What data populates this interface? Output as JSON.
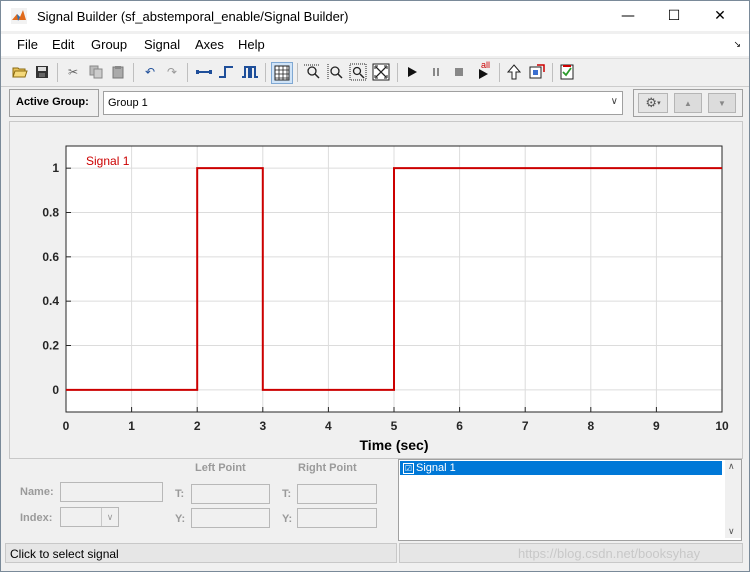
{
  "window": {
    "title": "Signal Builder (sf_abstemporal_enable/Signal Builder)",
    "controls": {
      "minimize": "—",
      "maximize": "☐",
      "close": "✕"
    }
  },
  "menu": {
    "items": [
      {
        "label": "File"
      },
      {
        "label": "Edit"
      },
      {
        "label": "Group"
      },
      {
        "label": "Signal"
      },
      {
        "label": "Axes"
      },
      {
        "label": "Help"
      }
    ],
    "overflow": "↘"
  },
  "toolbar": {
    "icons": [
      "open-icon",
      "save-icon",
      "cut-icon",
      "copy-icon",
      "paste-icon",
      "undo-icon",
      "redo-icon",
      "line-icon",
      "step-icon",
      "pulse-icon",
      "grid-toggle-icon",
      "zoom-x-icon",
      "zoom-y-icon",
      "zoom-xy-icon",
      "fit-icon",
      "play-icon",
      "pause-icon",
      "stop-icon",
      "play-all-icon",
      "arrow-up-icon",
      "model-icon",
      "verify-icon"
    ],
    "play_all_badge": "all"
  },
  "active_group": {
    "label": "Active Group:",
    "selected": "Group 1"
  },
  "chart_data": {
    "type": "line",
    "xlabel": "Time (sec)",
    "ylabel": "",
    "xlim": [
      0,
      10
    ],
    "ylim": [
      -0.1,
      1.1
    ],
    "xticks": [
      0,
      1,
      2,
      3,
      4,
      5,
      6,
      7,
      8,
      9,
      10
    ],
    "yticks": [
      0,
      0.2,
      0.4,
      0.6,
      0.8,
      1
    ],
    "ytick_labels": [
      "0",
      "0.2",
      "0.4",
      "0.6",
      "0.8",
      "1"
    ],
    "grid": true,
    "series": [
      {
        "name": "Signal 1",
        "color": "#cc0000",
        "x": [
          0,
          2,
          2,
          3,
          3,
          5,
          5,
          10
        ],
        "y": [
          0,
          0,
          1,
          1,
          0,
          0,
          1,
          1
        ]
      }
    ]
  },
  "point_editor": {
    "left_point": "Left Point",
    "right_point": "Right Point",
    "name_label": "Name:",
    "index_label": "Index:",
    "t_label": "T:",
    "y_label": "Y:"
  },
  "signal_list": {
    "items": [
      {
        "label": "Signal 1",
        "checked": "☑"
      }
    ]
  },
  "status": {
    "message": "Click to select signal"
  },
  "watermark": "https://blog.csdn.net/booksyhay"
}
